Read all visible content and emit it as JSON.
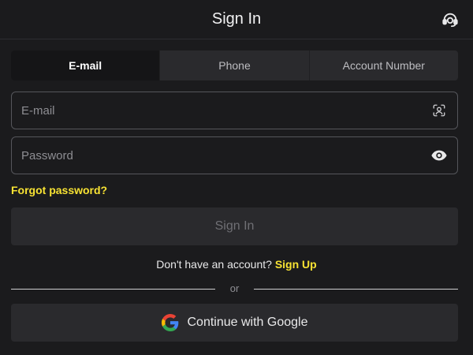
{
  "header": {
    "title": "Sign In",
    "support_icon": "headset-icon"
  },
  "tabs": [
    {
      "label": "E-mail",
      "active": true
    },
    {
      "label": "Phone",
      "active": false
    },
    {
      "label": "Account Number",
      "active": false
    }
  ],
  "email_field": {
    "placeholder": "E-mail",
    "value": "",
    "icon": "face-scan-icon"
  },
  "password_field": {
    "placeholder": "Password",
    "value": "",
    "icon": "eye-icon"
  },
  "forgot_password": "Forgot password?",
  "sign_in_button": "Sign In",
  "signup": {
    "prompt": "Don't have an account?",
    "link": "Sign Up"
  },
  "divider_text": "or",
  "google_button": "Continue with Google",
  "colors": {
    "background": "#1b1b1d",
    "surface": "#2a2a2d",
    "accent": "#f7e233",
    "active_tab": "#151517"
  }
}
